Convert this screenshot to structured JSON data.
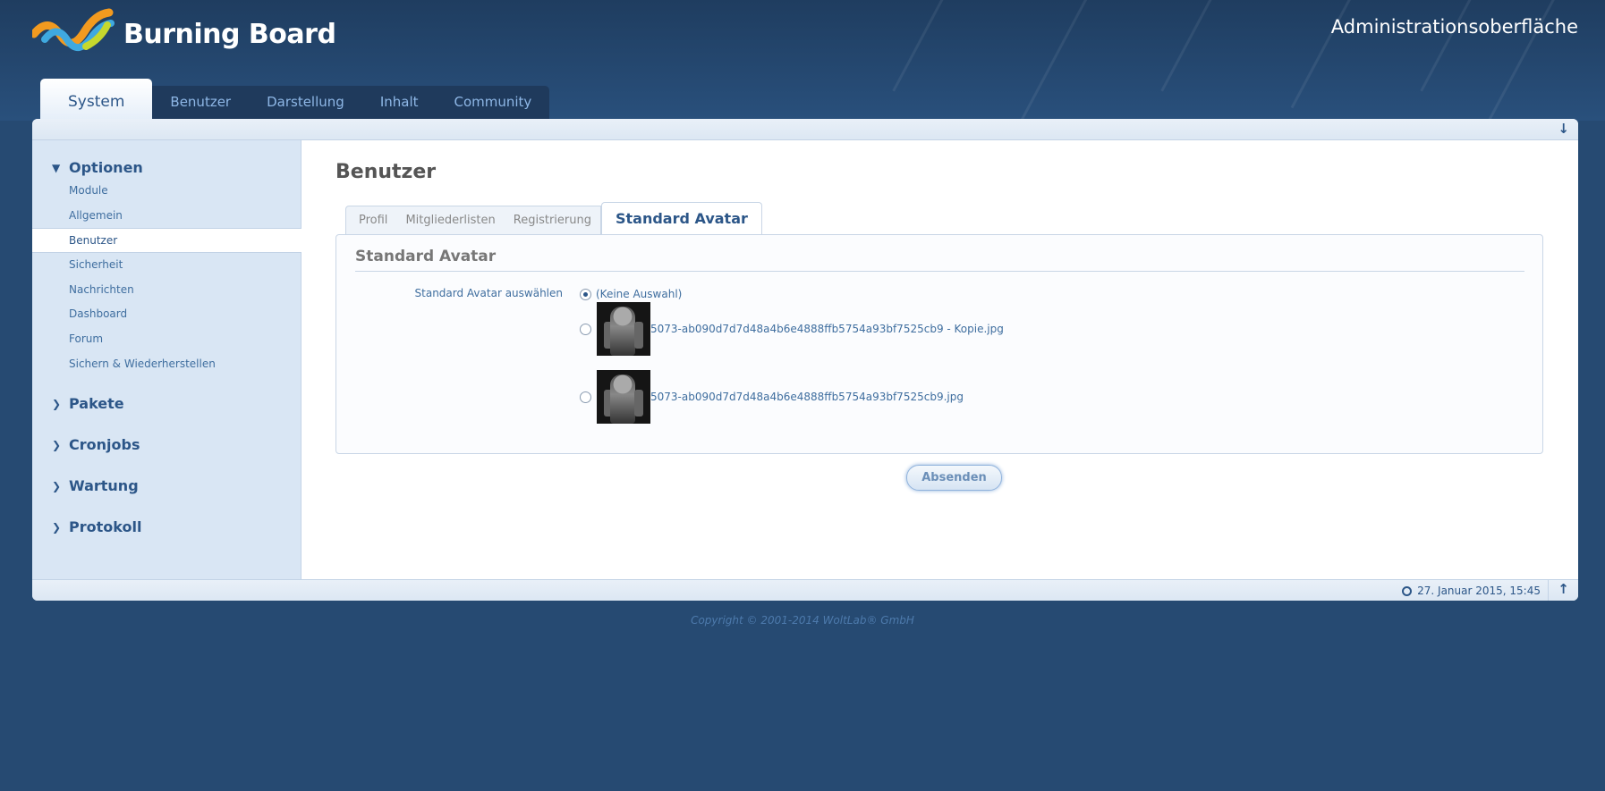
{
  "header": {
    "brand": "Burning Board",
    "admin_title": "Administrationsoberfläche"
  },
  "main_tabs": [
    "System",
    "Benutzer",
    "Darstellung",
    "Inhalt",
    "Community"
  ],
  "sidebar": {
    "optionen": {
      "label": "Optionen",
      "items": [
        "Module",
        "Allgemein",
        "Benutzer",
        "Sicherheit",
        "Nachrichten",
        "Dashboard",
        "Forum",
        "Sichern & Wiederherstellen"
      ],
      "active_item": "Benutzer"
    },
    "pakete": "Pakete",
    "cronjobs": "Cronjobs",
    "wartung": "Wartung",
    "protokoll": "Protokoll"
  },
  "content": {
    "title": "Benutzer",
    "tabs": [
      "Profil",
      "Mitgliederlisten",
      "Registrierung",
      "Standard Avatar"
    ],
    "active_tab": "Standard Avatar",
    "section_title": "Standard Avatar",
    "field_label": "Standard Avatar auswählen",
    "options": {
      "none": "(Keine Auswahl)",
      "file1": "5073-ab090d7d7d48a4b6e4888ffb5754a93bf7525cb9 - Kopie.jpg",
      "file2": "5073-ab090d7d7d48a4b6e4888ffb5754a93bf7525cb9.jpg"
    },
    "selected_option": "none",
    "submit_label": "Absenden"
  },
  "footer": {
    "datetime": "27. Januar 2015, 15:45",
    "copyright": "Copyright © 2001-2014 WoltLab® GmbH"
  },
  "colors": {
    "background": "#264a72",
    "accent": "#2c5688",
    "sidebar": "#d9e6f4"
  },
  "icons": [
    "logo-icon",
    "scroll-down-icon",
    "chevron-down-icon",
    "chevron-right-icon",
    "clock-icon",
    "scroll-up-icon"
  ]
}
